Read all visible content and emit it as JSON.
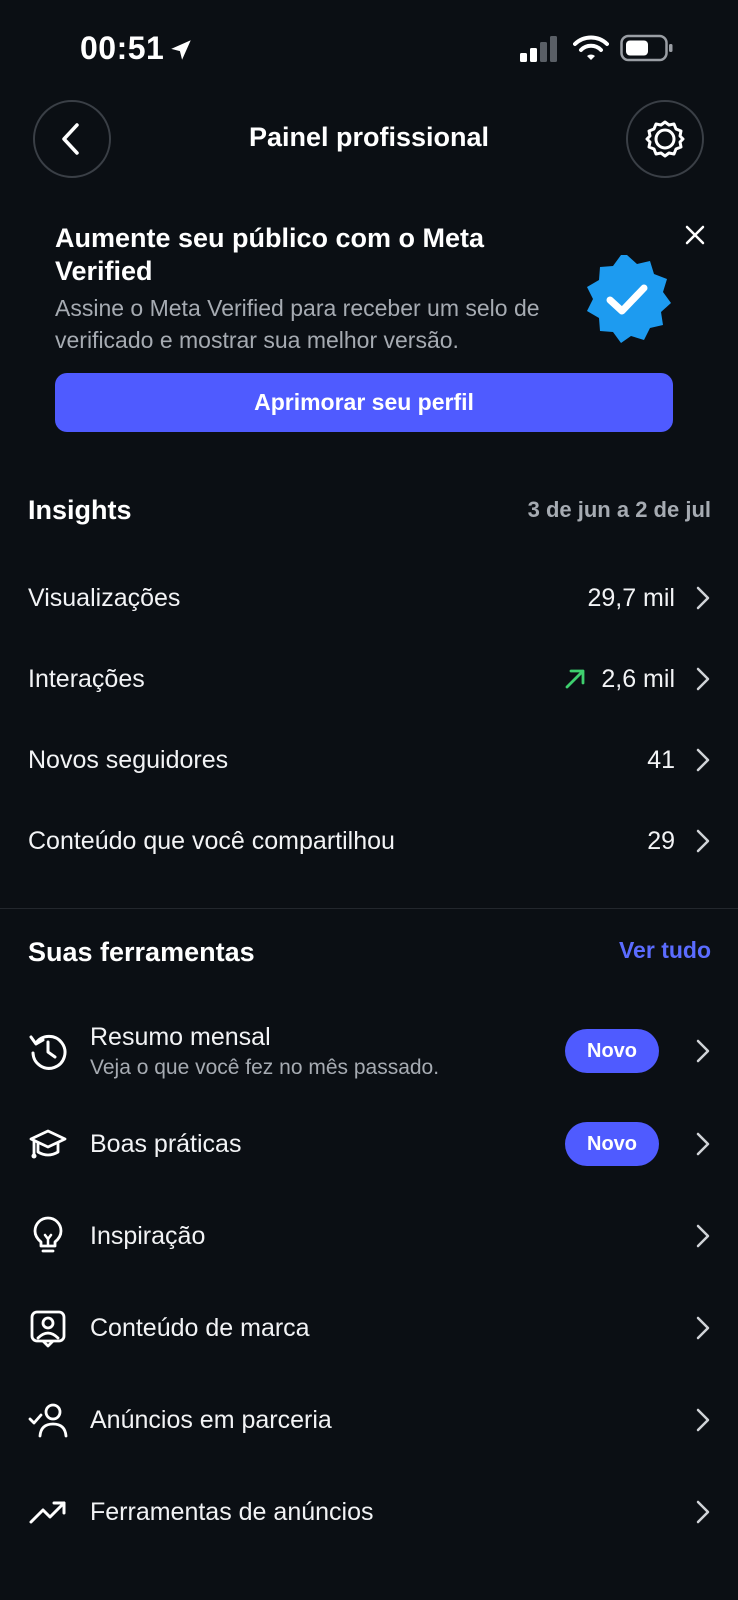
{
  "status_bar": {
    "time": "00:51"
  },
  "header": {
    "title": "Painel profissional"
  },
  "promo": {
    "title": "Aumente seu público com o Meta Verified",
    "description": "Assine o Meta Verified para receber um selo de verificado e mostrar sua melhor versão.",
    "cta_label": "Aprimorar seu perfil"
  },
  "insights": {
    "title": "Insights",
    "date_range": "3 de jun a 2 de jul",
    "rows": [
      {
        "label": "Visualizações",
        "value": "29,7 mil"
      },
      {
        "label": "Interações",
        "value": "2,6 mil",
        "trend": "up"
      },
      {
        "label": "Novos seguidores",
        "value": "41"
      },
      {
        "label": "Conteúdo que você compartilhou",
        "value": "29"
      }
    ]
  },
  "tools": {
    "title": "Suas ferramentas",
    "see_all": "Ver tudo",
    "items": [
      {
        "label": "Resumo mensal",
        "subtitle": "Veja o que você fez no mês passado.",
        "badge": "Novo",
        "icon": "history-icon"
      },
      {
        "label": "Boas práticas",
        "badge": "Novo",
        "icon": "graduation-cap-icon"
      },
      {
        "label": "Inspiração",
        "icon": "lightbulb-icon"
      },
      {
        "label": "Conteúdo de marca",
        "icon": "branded-content-icon"
      },
      {
        "label": "Anúncios em parceria",
        "icon": "partnership-icon"
      },
      {
        "label": "Ferramentas de anúncios",
        "icon": "trending-up-icon"
      }
    ]
  },
  "colors": {
    "background": "#0b0f14",
    "accent": "#4f5bff",
    "link": "#5b6cff",
    "trend_up": "#3ecf6e",
    "verified_blue": "#1d9bf0"
  }
}
